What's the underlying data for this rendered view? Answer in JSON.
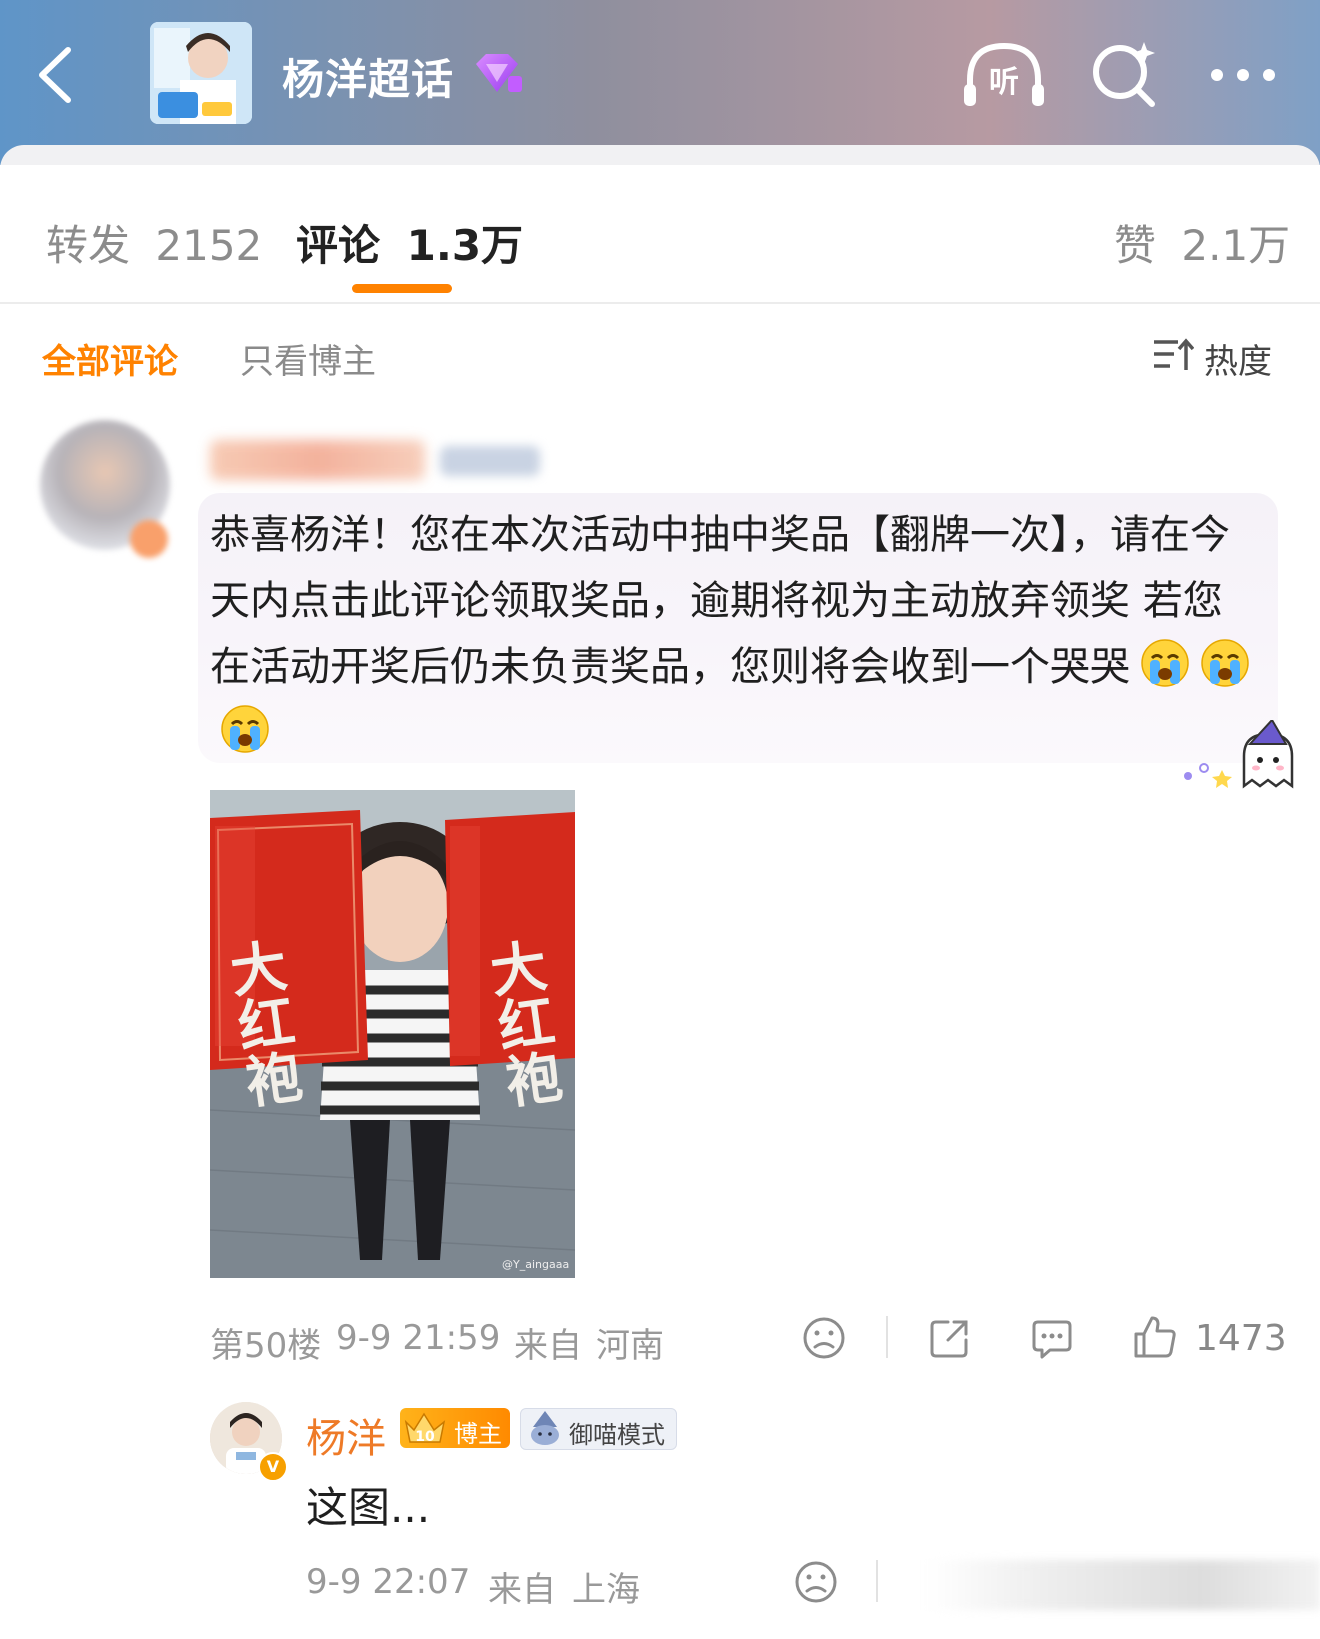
{
  "header": {
    "topic_title": "杨洋超话",
    "icons": {
      "back": "chevron-left-icon",
      "gem": "gem-badge-icon",
      "listen": "listen-icon",
      "search": "search-icon",
      "more": "more-dots-icon"
    },
    "listen_label": "听"
  },
  "tabs": [
    {
      "label": "转发",
      "count": "2152"
    },
    {
      "label": "评论",
      "count": "1.3万",
      "active": true
    },
    {
      "label": "赞",
      "count": "2.1万"
    }
  ],
  "filters": {
    "all": "全部评论",
    "blogger_only": "只看博主",
    "sort": "热度"
  },
  "comment": {
    "text": "恭喜杨洋！您在本次活动中抽中奖品【翻牌一次】，请在今天内点击此评论领取奖品，逾期将视为主动放弃领奖 若您在活动开奖后仍未负责奖品，您则将会收到一个哭哭",
    "photo_text": {
      "left_bag": "大红袍",
      "right_bag": "大红袍",
      "watermark": "@Y_aingaaa"
    },
    "floor": "第50楼",
    "time": "9-9 21:59",
    "from": "来自",
    "location": "河南",
    "likes": "1473"
  },
  "reply": {
    "name": "杨洋",
    "blogger_badge": "博主",
    "badge_level": "10",
    "mode_badge": "御喵模式",
    "vip_letter": "V",
    "text": "这图...",
    "time": "9-9 22:07",
    "from": "来自",
    "location": "上海"
  },
  "colors": {
    "accent": "#ff8200",
    "name_orange": "#ee7a27",
    "meta_gray": "#999999"
  }
}
